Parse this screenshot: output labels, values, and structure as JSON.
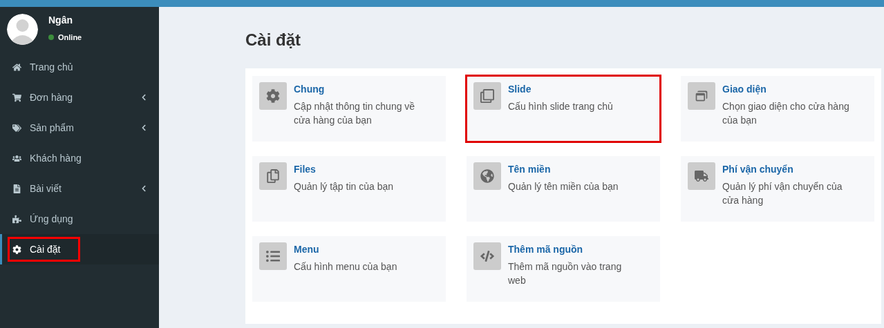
{
  "user": {
    "name": "Ngân",
    "status": "Online"
  },
  "sidebar": {
    "items": [
      {
        "label": "Trang chủ",
        "has_submenu": false,
        "selected": false,
        "highlighted": false
      },
      {
        "label": "Đơn hàng",
        "has_submenu": true,
        "selected": false,
        "highlighted": false
      },
      {
        "label": "Sản phẩm",
        "has_submenu": true,
        "selected": false,
        "highlighted": false
      },
      {
        "label": "Khách hàng",
        "has_submenu": false,
        "selected": false,
        "highlighted": false
      },
      {
        "label": "Bài viết",
        "has_submenu": true,
        "selected": false,
        "highlighted": false
      },
      {
        "label": "Ứng dụng",
        "has_submenu": false,
        "selected": false,
        "highlighted": false
      },
      {
        "label": "Cài đặt",
        "has_submenu": false,
        "selected": true,
        "highlighted": true
      }
    ]
  },
  "page": {
    "title": "Cài đặt"
  },
  "cards": [
    {
      "title": "Chung",
      "description": "Cập nhật thông tin chung về cửa hàng của bạn",
      "highlighted": false
    },
    {
      "title": "Slide",
      "description": "Cấu hình slide trang chủ",
      "highlighted": true
    },
    {
      "title": "Giao diện",
      "description": "Chọn giao diện cho cửa hàng của bạn",
      "highlighted": false
    },
    {
      "title": "Files",
      "description": "Quản lý tập tin của bạn",
      "highlighted": false
    },
    {
      "title": "Tên miền",
      "description": "Quản lý tên miền của bạn",
      "highlighted": false
    },
    {
      "title": "Phí vận chuyển",
      "description": "Quản lý phí vận chuyển của cửa hàng",
      "highlighted": false
    },
    {
      "title": "Menu",
      "description": "Cấu hình menu của bạn",
      "highlighted": false
    },
    {
      "title": "Thêm mã nguồn",
      "description": "Thêm mã nguồn vào trang web",
      "highlighted": false
    }
  ]
}
